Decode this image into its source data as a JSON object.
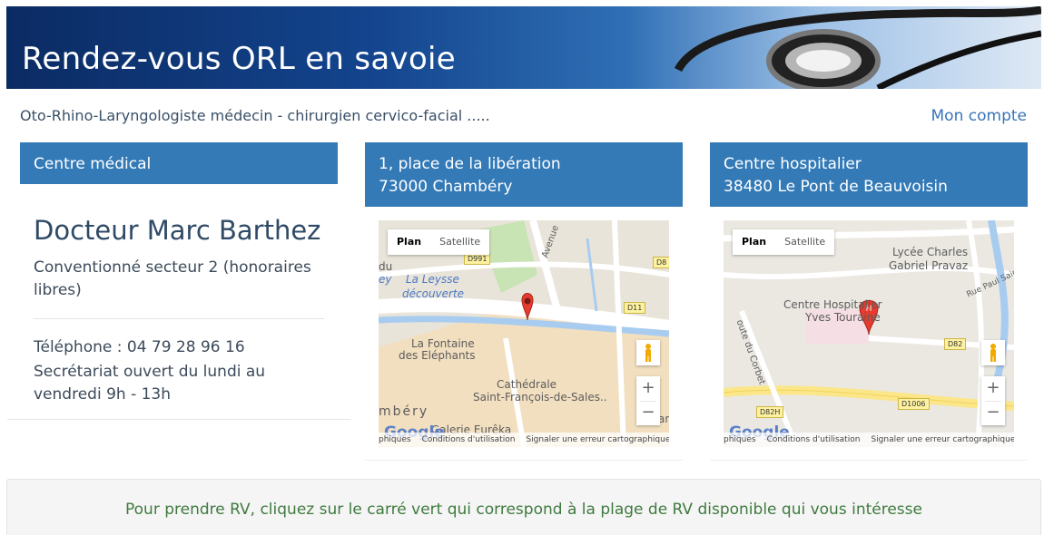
{
  "banner": {
    "title": "Rendez-vous ORL en savoie"
  },
  "subtitle": "Oto-Rhino-Laryngologiste médecin - chirurgien cervico-facial .....",
  "account_link": "Mon compte",
  "col1": {
    "header": "Centre médical",
    "doctor_name": "Docteur Marc Barthez",
    "convention": "Conventionné secteur 2 (honoraires libres)",
    "phone": "Téléphone : 04 79 28 96 16",
    "hours": "Secrétariat ouvert du lundi au vendredi 9h - 13h"
  },
  "col2": {
    "header_line1": "1, place de la libération",
    "header_line2": "73000 Chambéry",
    "map": {
      "type_plan": "Plan",
      "type_satellite": "Satellite",
      "labels": {
        "la_leysse": "La Leysse",
        "decouverte": "découverte",
        "fontaine_1": "La Fontaine",
        "fontaine_2": "des Eléphants",
        "cathedrale_1": "Cathédrale",
        "cathedrale_2": "Saint-François-de-Sales..",
        "galerie": "Galerie Eurêka",
        "chambery": "mbéry",
        "avenue": "Avenue",
        "du": "du",
        "ey": "ey",
        "ar": "ar"
      },
      "roads": {
        "d991": "D991",
        "d8": "D8",
        "d11": "D11"
      },
      "zoom_in": "+",
      "zoom_out": "−",
      "footer": {
        "data": "phiques",
        "terms": "Conditions d'utilisation",
        "report": "Signaler une erreur cartographique"
      },
      "google": "Google"
    }
  },
  "col3": {
    "header_line1": "Centre hospitalier",
    "header_line2": "38480 Le Pont de Beauvoisin",
    "map": {
      "type_plan": "Plan",
      "type_satellite": "Satellite",
      "labels": {
        "lycee_1": "Lycée Charles",
        "lycee_2": "Gabriel Pravaz",
        "hospital_1": "Centre Hospitalier",
        "hospital_2": "Yves Touraine",
        "route_corbet": "oute du Corbet",
        "rue": "Rue Paul Saint-M"
      },
      "roads": {
        "d82": "D82",
        "d82h": "D82H",
        "d1006": "D1006"
      },
      "zoom_in": "+",
      "zoom_out": "−",
      "footer": {
        "data": "phiques",
        "terms": "Conditions d'utilisation",
        "report": "Signaler une erreur cartographique"
      },
      "google": "Google"
    }
  },
  "info": "Pour prendre RV, cliquez sur le carré vert qui correspond à la plage de RV disponible qui vous intéresse",
  "colors": {
    "header_blue": "#337ab7",
    "info_green": "#3f7a3f",
    "link_blue": "#3a74b8"
  }
}
